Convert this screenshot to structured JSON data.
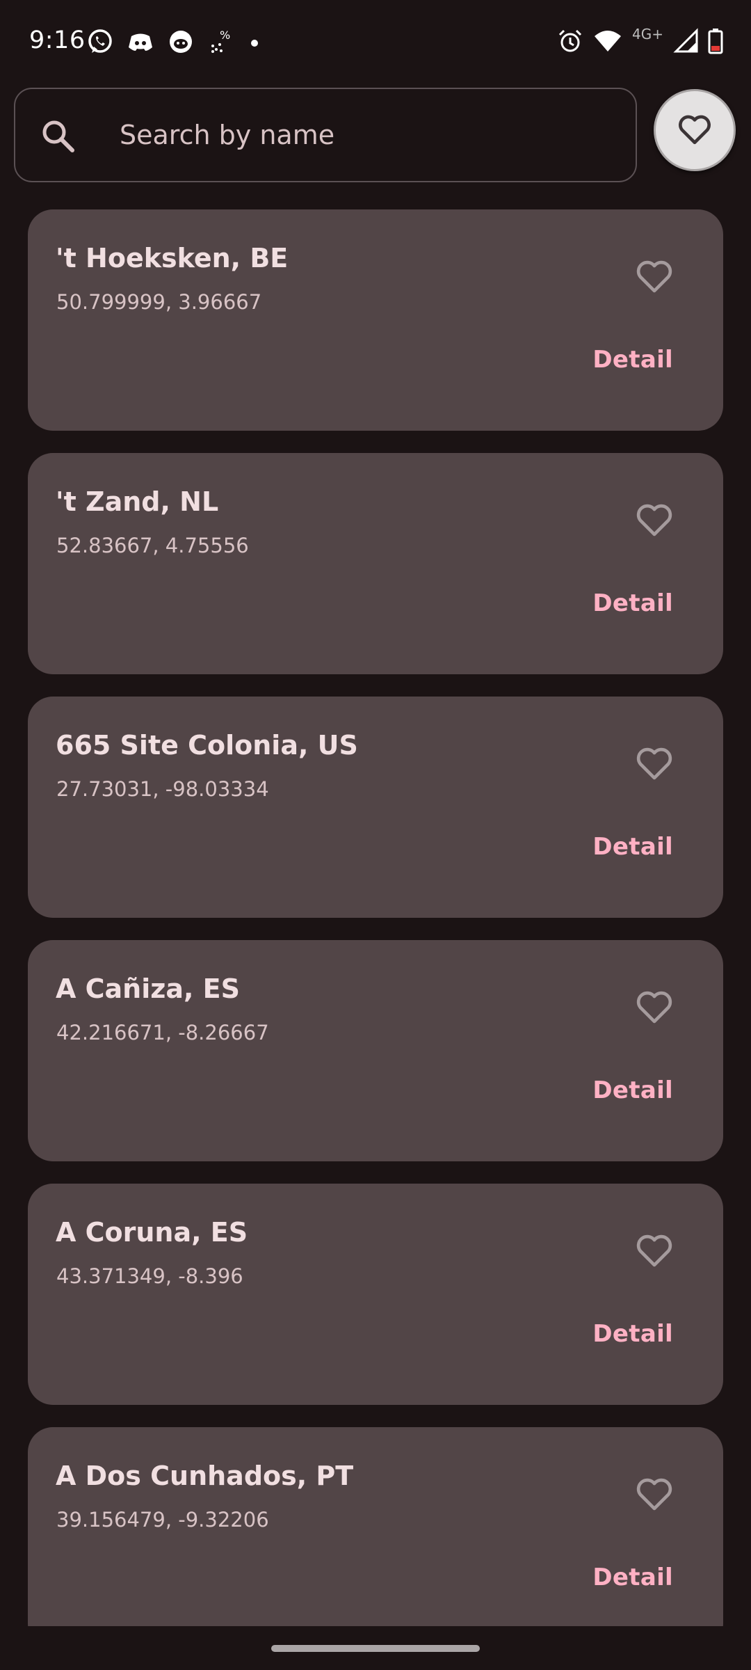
{
  "status_bar": {
    "time": "9:16",
    "left_icons": [
      "whatsapp-icon",
      "discord-icon",
      "reddit-icon",
      "percent-app-icon",
      "dot-icon"
    ],
    "right_icons": [
      "alarm-icon",
      "wifi-icon",
      "signal-icon",
      "battery-icon"
    ],
    "network": "4G+",
    "battery_color": "#e53935"
  },
  "search": {
    "placeholder": "Search by name",
    "value": ""
  },
  "favorites_button": {
    "icon": "heart-outline-icon"
  },
  "colors": {
    "background": "#1b1314",
    "card": "#524547",
    "accent": "#ffb1c4",
    "title": "#f1dfe1"
  },
  "cities": [
    {
      "name": "'t Hoeksken, BE",
      "coords": "50.799999, 3.96667",
      "detail_label": "Detail",
      "favorite": false
    },
    {
      "name": "'t Zand, NL",
      "coords": "52.83667, 4.75556",
      "detail_label": "Detail",
      "favorite": false
    },
    {
      "name": "665 Site Colonia, US",
      "coords": "27.73031, -98.03334",
      "detail_label": "Detail",
      "favorite": false
    },
    {
      "name": "A Cañiza, ES",
      "coords": "42.216671, -8.26667",
      "detail_label": "Detail",
      "favorite": false
    },
    {
      "name": "A Coruna, ES",
      "coords": "43.371349, -8.396",
      "detail_label": "Detail",
      "favorite": false
    },
    {
      "name": "A Dos Cunhados, PT",
      "coords": "39.156479, -9.32206",
      "detail_label": "Detail",
      "favorite": false
    }
  ]
}
